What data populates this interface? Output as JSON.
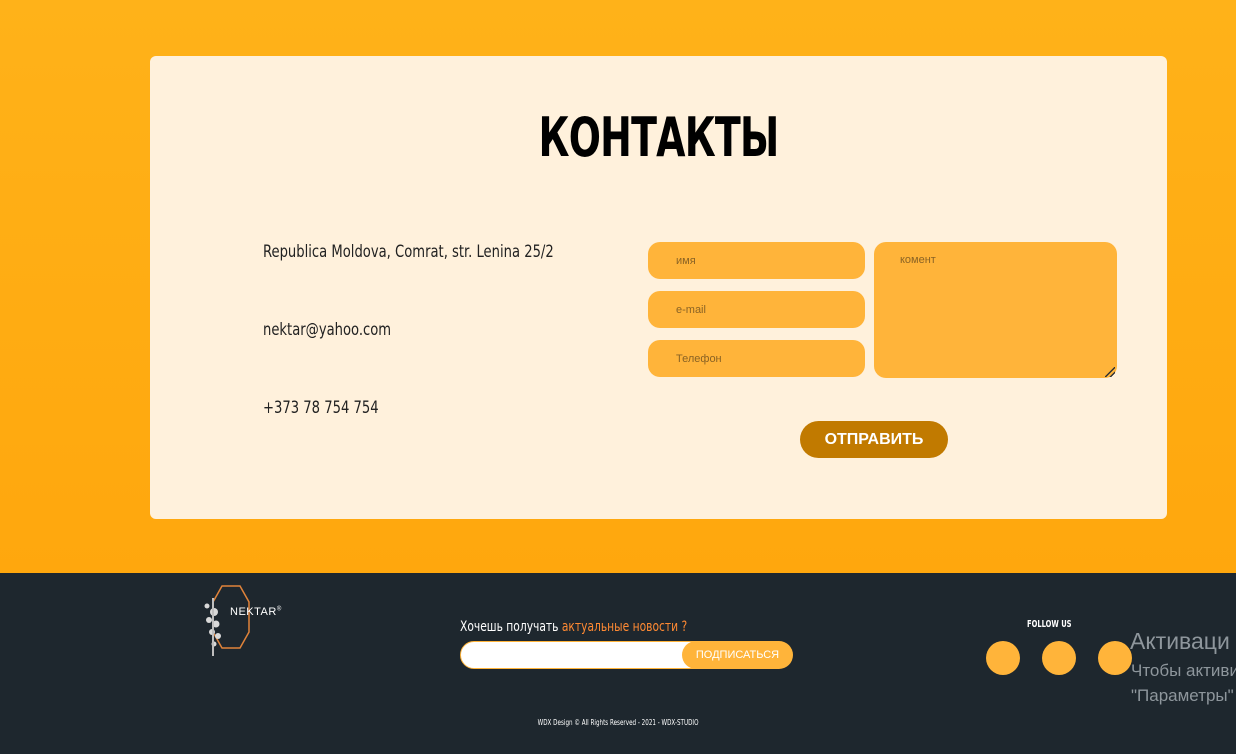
{
  "contacts": {
    "title": "КОНТАКТЫ",
    "address": "Republica Moldova, Comrat, str. Lenina 25/2",
    "email": "nektar@yahoo.com",
    "phone": "+373 78 754 754"
  },
  "form": {
    "name_placeholder": "имя",
    "email_placeholder": "e-mail",
    "phone_placeholder": "Телефон",
    "comment_placeholder": "комент",
    "submit_label": "ОТПРАВИТЬ"
  },
  "footer": {
    "logo_text": "NEKTAR",
    "logo_mark": "®",
    "newsletter_prefix": "Хочешь получать ",
    "newsletter_accent": "актуальные новости ?",
    "subscribe_label": "ПОДПИСАТЬСЯ",
    "follow_us": "FOLLOW US",
    "copyright": "WDX Design © All Rights Reserved - 2021 - WDX-STUDIO"
  },
  "windows_activation": {
    "title": "Активаци",
    "line1": "Чтобы активи",
    "line2": "\"Параметры\""
  },
  "colors": {
    "background": "#ffab12",
    "card": "#fff1dc",
    "field": "#ffb43a",
    "button": "#c17a00",
    "footer": "#1e272e",
    "accent": "#ff8a33"
  }
}
